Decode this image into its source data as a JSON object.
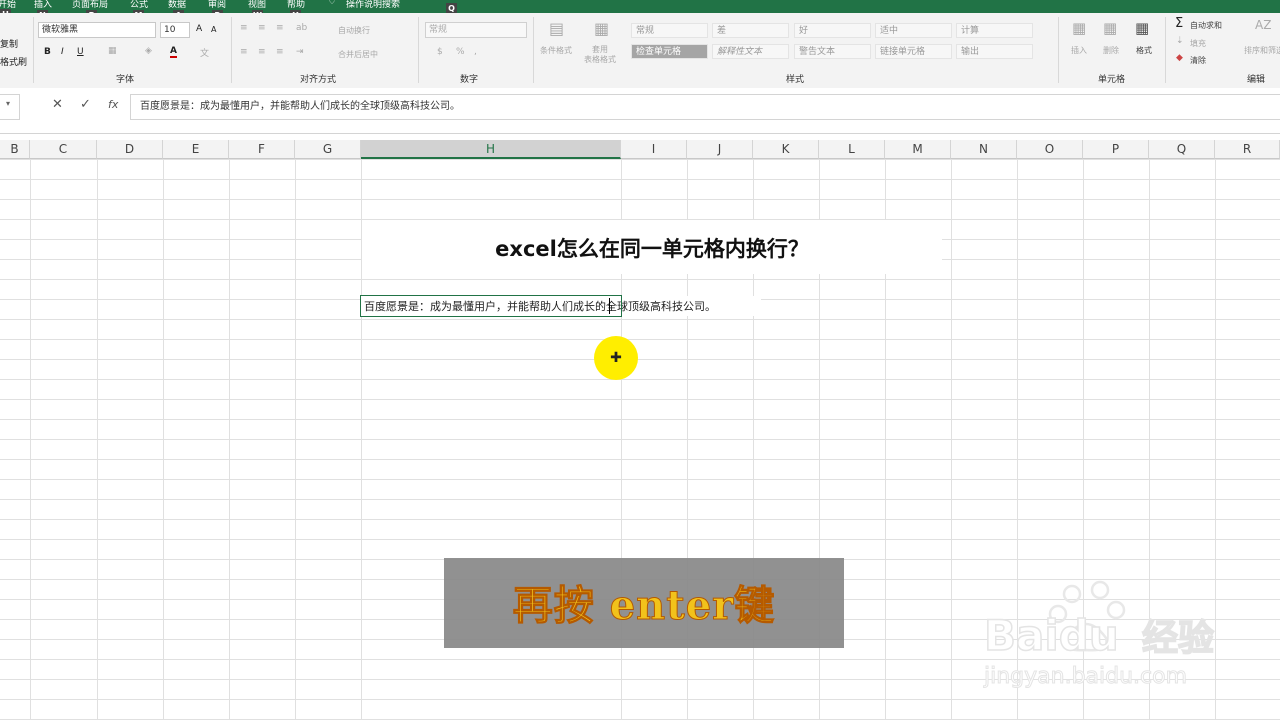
{
  "ribbon_tabs": [
    "开始",
    "插入",
    "页面布局",
    "公式",
    "数据",
    "审阅",
    "视图",
    "帮助"
  ],
  "tell_me": "操作说明搜索",
  "keytips": [
    "H",
    "N",
    "P",
    "M",
    "A",
    "R",
    "W",
    "Y",
    "Q"
  ],
  "clipboard": {
    "copy": "复制",
    "painter": "格式刷"
  },
  "font": {
    "name": "微软雅黑",
    "size": "10",
    "group": "字体",
    "bold": "B",
    "italic": "I",
    "underline": "U",
    "grow": "A",
    "shrink": "A"
  },
  "alignment": {
    "wrap": "自动换行",
    "merge": "合并后居中",
    "group": "对齐方式"
  },
  "number": {
    "format": "常规",
    "group": "数字",
    "percent": "%",
    "comma": ","
  },
  "styles_btns": {
    "cond": "条件格式",
    "table": "套用\n表格格式",
    "group": "样式"
  },
  "style_cells": [
    [
      "常规",
      "差",
      "好",
      "适中",
      "计算"
    ],
    [
      "检查单元格",
      "解释性文本",
      "警告文本",
      "链接单元格",
      "输出"
    ]
  ],
  "cells_group": {
    "insert": "插入",
    "delete": "删除",
    "format": "格式",
    "group": "单元格"
  },
  "editing": {
    "autosum": "自动求和",
    "fill": "填充",
    "clear": "清除",
    "sort": "排序和筛选",
    "group": "编辑"
  },
  "formula_bar": {
    "content": "百度愿景是：成为最懂用户，并能帮助人们成长的全球顶级高科技公司。",
    "fx": "fx"
  },
  "columns": [
    "B",
    "C",
    "D",
    "E",
    "F",
    "G",
    "H",
    "I",
    "J",
    "K",
    "L",
    "M",
    "N",
    "O",
    "P",
    "Q",
    "R"
  ],
  "sheet": {
    "title": "excel怎么在同一单元格内换行？",
    "cell_text": "百度愿景是：成为最懂用户，并能帮助人们成长的全球顶级高科技公司。"
  },
  "banner": "再按 enter键",
  "watermark": {
    "brand": "Baidu",
    "cn": "经验",
    "url": "jingyan.baidu.com"
  }
}
